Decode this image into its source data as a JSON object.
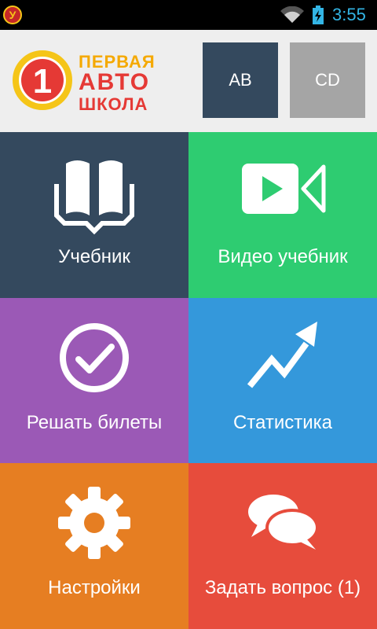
{
  "status_bar": {
    "app_icon": "У",
    "time": "3:55",
    "icons": [
      "app-badge-icon",
      "wifi-icon",
      "battery-charging-icon"
    ]
  },
  "header": {
    "logo": {
      "digit": "1",
      "line1": "ПЕРВАЯ",
      "line2": "АВТО",
      "line3": "ШКОЛА"
    },
    "levels": [
      {
        "label": "AB",
        "color": "#34495e"
      },
      {
        "label": "CD",
        "color": "#a5a5a5"
      }
    ]
  },
  "menu": {
    "tiles": [
      {
        "label": "Учебник",
        "icon": "open-book-icon",
        "color": "#34495e"
      },
      {
        "label": "Видео учебник",
        "icon": "video-camera-icon",
        "color": "#2ecc71"
      },
      {
        "label": "Решать билеты",
        "icon": "checkmark-circle-icon",
        "color": "#9b59b6"
      },
      {
        "label": "Статистика",
        "icon": "trend-arrow-icon",
        "color": "#3498db"
      },
      {
        "label": "Настройки",
        "icon": "gear-icon",
        "color": "#e67e22"
      },
      {
        "label": "Задать вопрос (1)",
        "icon": "chat-bubbles-icon",
        "color": "#e74c3c"
      }
    ]
  }
}
